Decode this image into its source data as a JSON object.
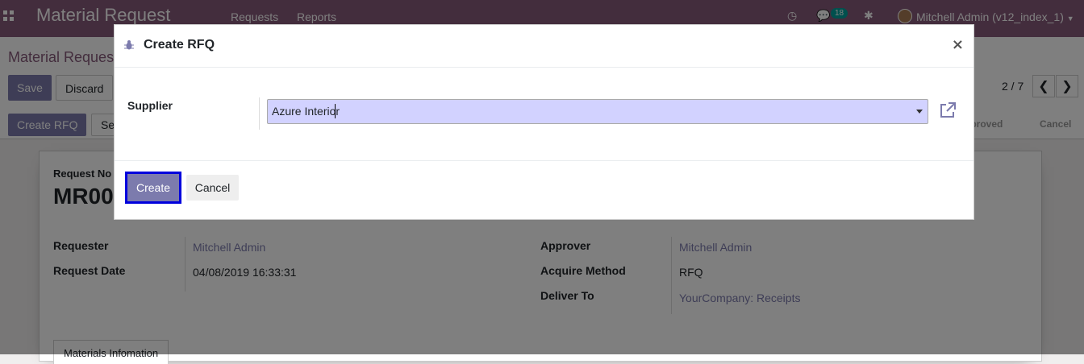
{
  "navbar": {
    "app_title": "Material Request",
    "menu": [
      "Requests",
      "Reports"
    ],
    "message_count": "18",
    "user": "Mitchell Admin (v12_index_1)"
  },
  "control_panel": {
    "breadcrumb": "Material Request",
    "save_label": "Save",
    "discard_label": "Discard",
    "pager": "2 / 7",
    "prev_icon": "chevron-left-icon",
    "next_icon": "chevron-right-icon"
  },
  "statusbar": {
    "create_rfq_label": "Create RFQ",
    "next_button_partial": "Se",
    "stages": [
      "pproved",
      "Cancel"
    ]
  },
  "form": {
    "request_no_label": "Request No",
    "request_no_value": "MR00",
    "requester_label": "Requester",
    "requester_value": "Mitchell Admin",
    "request_date_label": "Request Date",
    "request_date_value": "04/08/2019 16:33:31",
    "approver_label": "Approver",
    "approver_value": "Mitchell Admin",
    "acquire_method_label": "Acquire Method",
    "acquire_method_value": "RFQ",
    "deliver_to_label": "Deliver To",
    "deliver_to_value": "YourCompany: Receipts",
    "tab_label": "Materials Infomation"
  },
  "modal": {
    "title": "Create RFQ",
    "supplier_label": "Supplier",
    "supplier_value": "Azure Interior",
    "create_label": "Create",
    "cancel_label": "Cancel"
  },
  "colors": {
    "brand": "#875a7b",
    "primary": "#7c7bad",
    "input_highlight": "#d2d2ff",
    "focus_border": "#0000dd"
  }
}
